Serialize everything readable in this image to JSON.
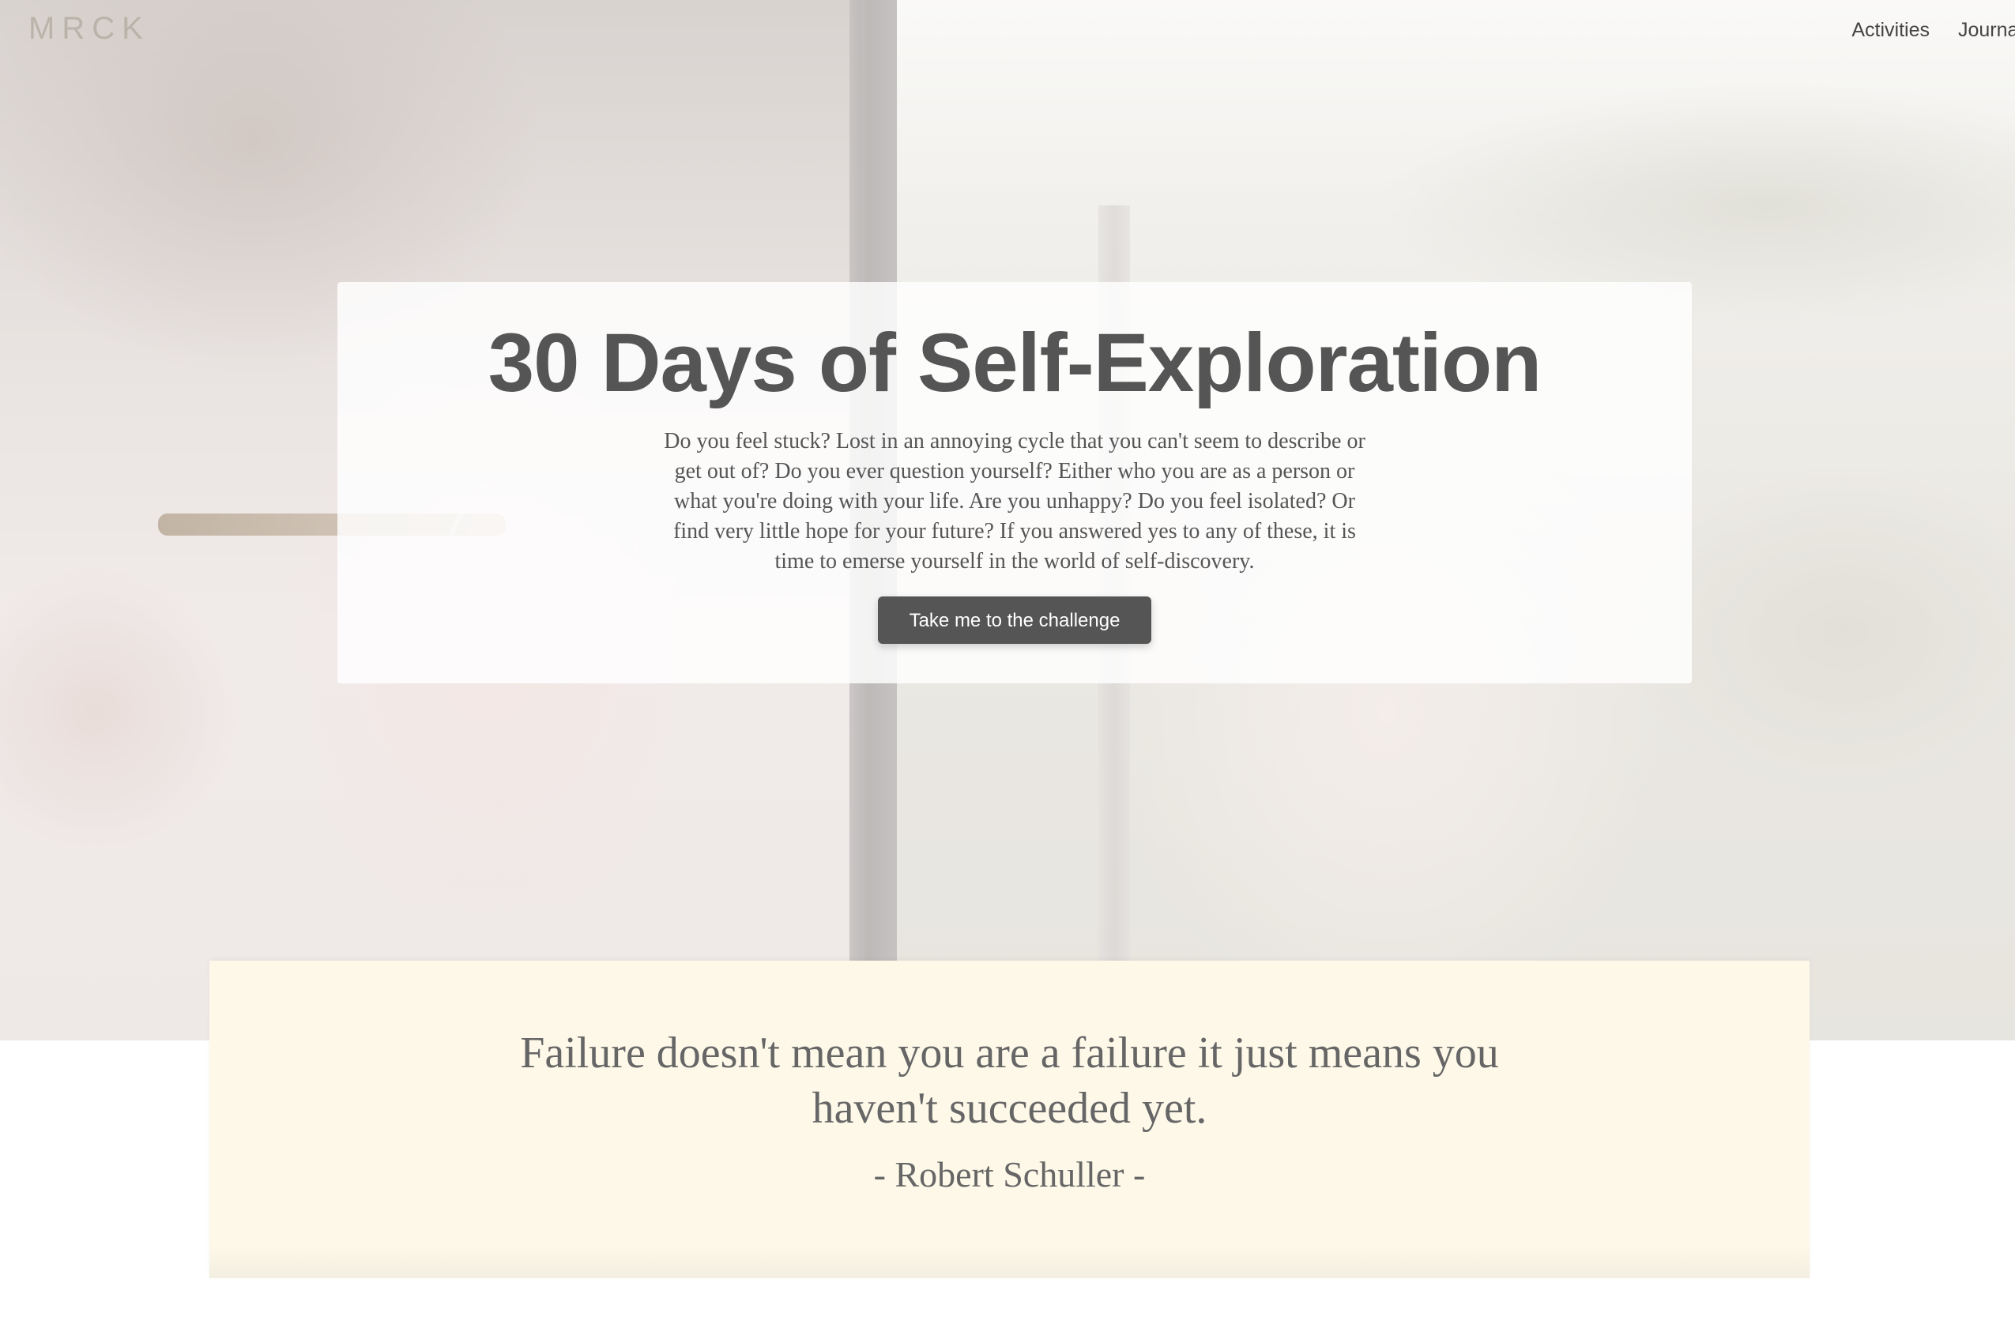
{
  "brand": {
    "logo_text": "MRCK"
  },
  "nav": {
    "items": [
      {
        "label": "Activities"
      },
      {
        "label": "Journal"
      }
    ]
  },
  "hero": {
    "title": "30 Days of Self-Exploration",
    "description": "Do you feel stuck? Lost in an annoying cycle that you can't seem to describe or get out of? Do you ever question yourself? Either who you are as a person or what you're doing with your life. Are you unhappy? Do you feel isolated? Or find very little hope for your future? If you answered yes to any of these, it is time to emerse yourself in the world of self-discovery.",
    "cta_label": "Take me to the challenge"
  },
  "quote": {
    "text": "Failure doesn't mean you are a failure it just means you haven't succeeded yet.",
    "author": "- Robert Schuller -"
  },
  "colors": {
    "text_dark": "#555555",
    "quote_background": "#fdf8e8",
    "logo": "#b9b3a9"
  }
}
